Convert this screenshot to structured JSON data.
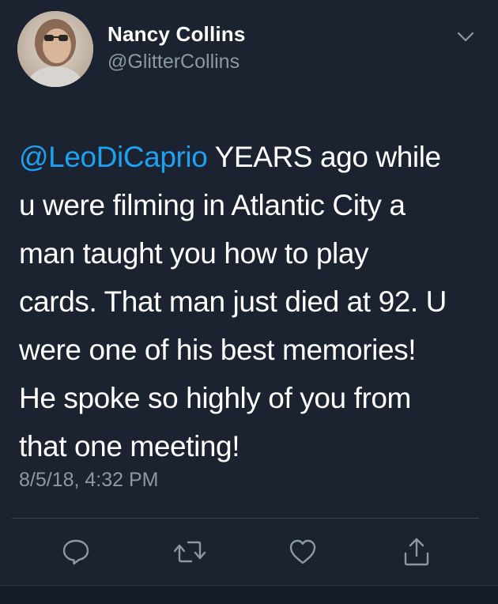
{
  "user": {
    "display_name": "Nancy Collins",
    "handle": "@GlitterCollins"
  },
  "tweet": {
    "lines": [
      {
        "mention": "@LeoDiCaprio",
        "text": " YEARS ago while"
      },
      {
        "text": "u were filming in Atlantic City a"
      },
      {
        "text": "man taught you how to play"
      },
      {
        "text": "cards. That man just died at 92. U"
      },
      {
        "text": "were one of his best memories!"
      },
      {
        "text": "He spoke so highly of you from"
      },
      {
        "text": "that one meeting!"
      }
    ],
    "timestamp": "8/5/18, 4:32 PM"
  },
  "actions": [
    {
      "icon": "reply-icon"
    },
    {
      "icon": "retweet-icon"
    },
    {
      "icon": "like-icon"
    },
    {
      "icon": "share-icon"
    }
  ],
  "colors": {
    "background": "#1c2330",
    "text": "#ffffff",
    "secondary": "#8b98a5",
    "accent": "#1da1f2",
    "divider": "#3a4452"
  }
}
